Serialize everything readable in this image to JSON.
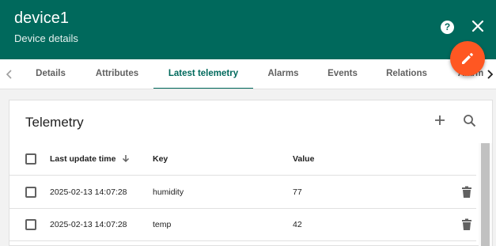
{
  "header": {
    "title": "device1",
    "subtitle": "Device details",
    "help_icon": "help-icon",
    "close_icon": "close-icon",
    "color": "#00695c"
  },
  "fab": {
    "icon": "edit-icon",
    "color": "#ff5722"
  },
  "tabs": [
    {
      "label": "Details"
    },
    {
      "label": "Attributes"
    },
    {
      "label": "Latest telemetry",
      "active": true
    },
    {
      "label": "Alarms"
    },
    {
      "label": "Events"
    },
    {
      "label": "Relations"
    },
    {
      "label": "Alarm"
    }
  ],
  "telemetry": {
    "title": "Telemetry",
    "columns": {
      "time": "Last update time",
      "key": "Key",
      "value": "Value"
    },
    "sort_icon": "arrow-down-icon",
    "rows": [
      {
        "time": "2025-02-13 14:07:28",
        "key": "humidity",
        "value": "77"
      },
      {
        "time": "2025-02-13 14:07:28",
        "key": "temp",
        "value": "42"
      }
    ]
  }
}
